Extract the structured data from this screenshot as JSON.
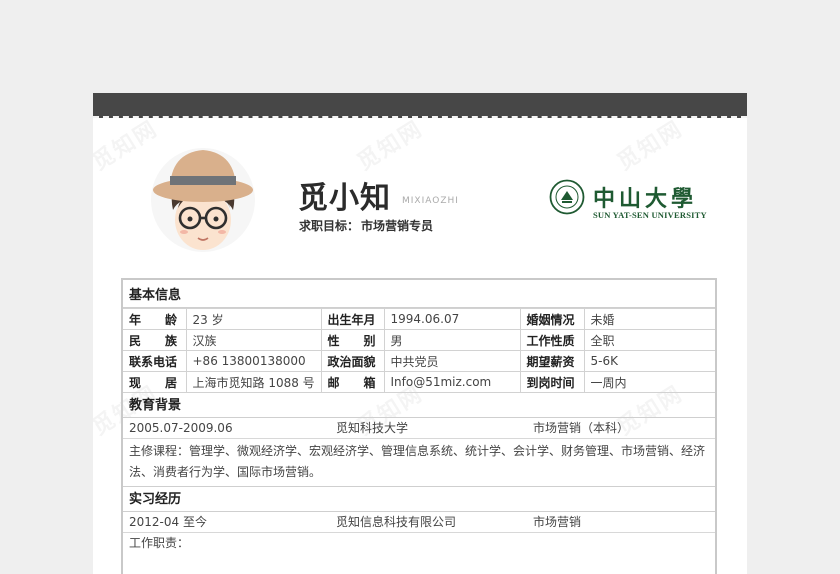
{
  "profile": {
    "name": "觅小知",
    "pinyin": "MIXIAOZHI",
    "objective_label": "求职目标：",
    "objective_value": "市场营销专员"
  },
  "logo": {
    "title": "中山大學",
    "subtitle": "SUN YAT-SEN UNIVERSITY"
  },
  "basic": {
    "title": "基本信息",
    "rows": [
      [
        {
          "label": "年　　龄",
          "value": "23 岁"
        },
        {
          "label": "出生年月",
          "value": "1994.06.07"
        },
        {
          "label": "婚姻情况",
          "value": "未婚"
        }
      ],
      [
        {
          "label": "民　　族",
          "value": "汉族"
        },
        {
          "label": "性　　别",
          "value": "男"
        },
        {
          "label": "工作性质",
          "value": "全职"
        }
      ],
      [
        {
          "label": "联系电话",
          "value": "+86 13800138000"
        },
        {
          "label": "政治面貌",
          "value": "中共党员"
        },
        {
          "label": "期望薪资",
          "value": "5-6K"
        }
      ],
      [
        {
          "label": "现　　居",
          "value": "上海市觅知路 1088 号"
        },
        {
          "label": "邮　　箱",
          "value": "Info@51miz.com"
        },
        {
          "label": "到岗时间",
          "value": "一周内"
        }
      ]
    ]
  },
  "education": {
    "title": "教育背景",
    "period": "2005.07-2009.06",
    "school": "觅知科技大学",
    "major": "市场营销（本科）",
    "courses": "主修课程：管理学、微观经济学、宏观经济学、管理信息系统、统计学、会计学、财务管理、市场营销、经济法、消费者行为学、国际市场营销。"
  },
  "internship": {
    "title": "实习经历",
    "period": "2012-04 至今",
    "company": "觅知信息科技有限公司",
    "role": "市场营销",
    "duty_label": "工作职责："
  },
  "watermark": "觅知网",
  "colors": {
    "topbar": "#474747",
    "logo_green": "#1f5a32",
    "border": "#c9c9c9"
  }
}
